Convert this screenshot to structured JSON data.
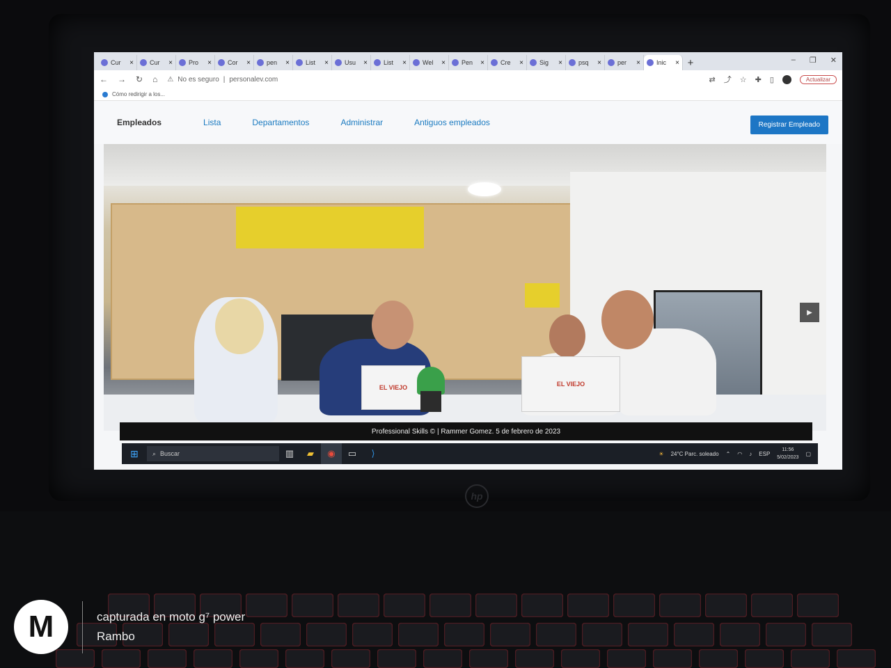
{
  "browser": {
    "tabs": [
      {
        "label": "Cur",
        "icon": "course-icon"
      },
      {
        "label": "Cur",
        "icon": "course-icon"
      },
      {
        "label": "Pro",
        "icon": "notion-icon"
      },
      {
        "label": "Cor",
        "icon": "youtube-icon"
      },
      {
        "label": "pen",
        "icon": "github-icon"
      },
      {
        "label": "List",
        "icon": "globe-icon"
      },
      {
        "label": "Usu",
        "icon": "ubuntu-icon"
      },
      {
        "label": "List",
        "icon": "globe-icon"
      },
      {
        "label": "Wel",
        "icon": "globe-icon"
      },
      {
        "label": "Pen",
        "icon": "linkedin-icon"
      },
      {
        "label": "Cre",
        "icon": "globe-icon"
      },
      {
        "label": "Sig",
        "icon": "app-icon"
      },
      {
        "label": "psq",
        "icon": "pencil-icon"
      },
      {
        "label": "per",
        "icon": "globe-icon"
      },
      {
        "label": "Inic",
        "icon": "globe-icon",
        "active": true
      }
    ],
    "new_tab": "+",
    "security_label": "No es seguro",
    "separator": "|",
    "url": "personalev.com",
    "update_button": "Actualizar",
    "bookmark": "Cómo redirigir a los..."
  },
  "site": {
    "nav": {
      "brand": "Empleados",
      "links": [
        "Lista",
        "Departamentos",
        "Administrar",
        "Antiguos empleados"
      ]
    },
    "register_button": "Registrar Empleado",
    "hero_logo_text": "EL VIEJO",
    "footer": "Professional Skills © | Rammer Gomez. 5 de febrero de 2023"
  },
  "taskbar": {
    "search_placeholder": "Buscar",
    "weather": "24°C  Parc. soleado",
    "language": "ESP",
    "time": "11:56",
    "date": "5/02/2023"
  },
  "watermark": {
    "line1": "capturada en moto g⁷ power",
    "line2": "Rambo"
  },
  "colors": {
    "accent": "#1d76c5",
    "link": "#1a7ac0",
    "keyboard_backlight": "#b2232c"
  }
}
